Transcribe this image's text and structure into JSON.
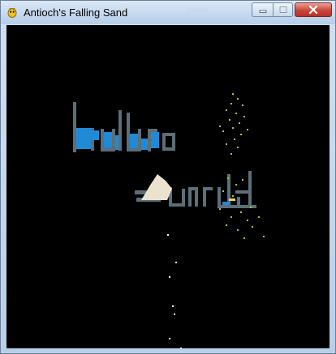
{
  "window": {
    "title": "Antioch's Falling Sand",
    "ghost_title": "Yahoo",
    "controls": {
      "minimize_icon": "minimize-icon",
      "maximize_icon": "maximize-icon",
      "close_icon": "close-icon"
    }
  },
  "canvas": {
    "background": "#000000",
    "colors": {
      "wall": "#5c6f78",
      "water": "#1f8ad6",
      "sand": "#ece3cf",
      "plant_dust": "#a9c43a",
      "falling_dust": "#ffffff"
    }
  }
}
